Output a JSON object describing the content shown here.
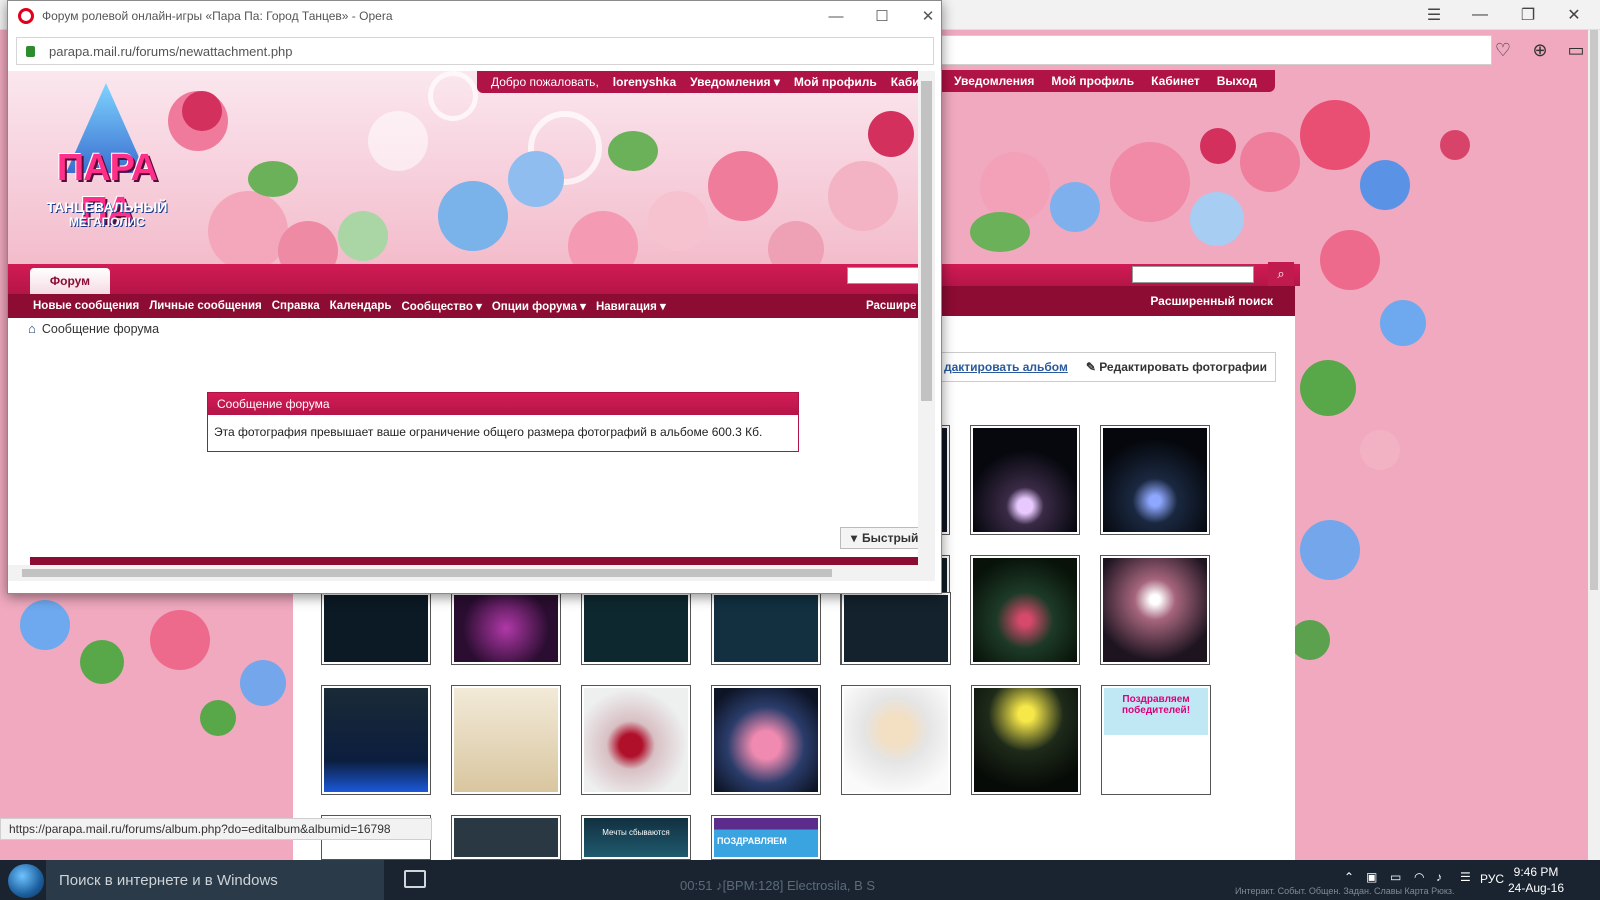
{
  "front_window": {
    "title": "Форум ролевой онлайн-игры «Пара Па: Город Танцев» - Opera",
    "url": "parapa.mail.ru/forums/newattachment.php",
    "logo_line1": "ПАРА ПА",
    "logo_line2": "ТАНЦЕВАЛЬНЫЙ",
    "logo_line3": "МЕГАПОЛИС",
    "topbar": {
      "welcome": "Добро пожаловать,",
      "username": "lorenyshka",
      "notifications": "Уведомления",
      "profile": "Мой профиль",
      "cabinet": "Кабинет"
    },
    "tab_forum": "Форум",
    "subnav": [
      "Новые сообщения",
      "Личные сообщения",
      "Справка",
      "Календарь",
      "Сообщество",
      "Опции форума",
      "Навигация"
    ],
    "subnav_adv": "Расшире",
    "breadcrumb": "Сообщение форума",
    "message_title": "Сообщение форума",
    "message_text": "Эта фотография превышает ваше ограничение общего размера фотографий в альбоме 600.3 Кб.",
    "quick_button": "Быстрый"
  },
  "back_window": {
    "topbar": [
      "Уведомления",
      "Мой профиль",
      "Кабинет",
      "Выход"
    ],
    "advanced_search": "Расширенный поиск",
    "edit_album": "дактировать альбом",
    "edit_photos": "Редактировать фотографии",
    "thumb_text_1": "Поздравляем победителей!",
    "thumb_text_2": "ПОЗДРАВЛЯЕМ",
    "thumb_text_3": "Мечты сбываются"
  },
  "status_url": "https://parapa.mail.ru/forums/album.php?do=editalbum&albumid=16798",
  "taskbar": {
    "search_placeholder": "Поиск в интернете и в Windows",
    "media_text": "00:51  ♪[BPM:128] Electrosila, B S",
    "tray_labels": "Интеракт.  Событ.  Общен.  Задан.  Славы  Карта  Рюкз.",
    "language": "РУС",
    "time": "9:46 PM",
    "date": "24-Aug-16"
  },
  "colors": {
    "brand": "#b01346",
    "brand_dark": "#8c0c33",
    "background_pink": "#f0a9bf"
  }
}
